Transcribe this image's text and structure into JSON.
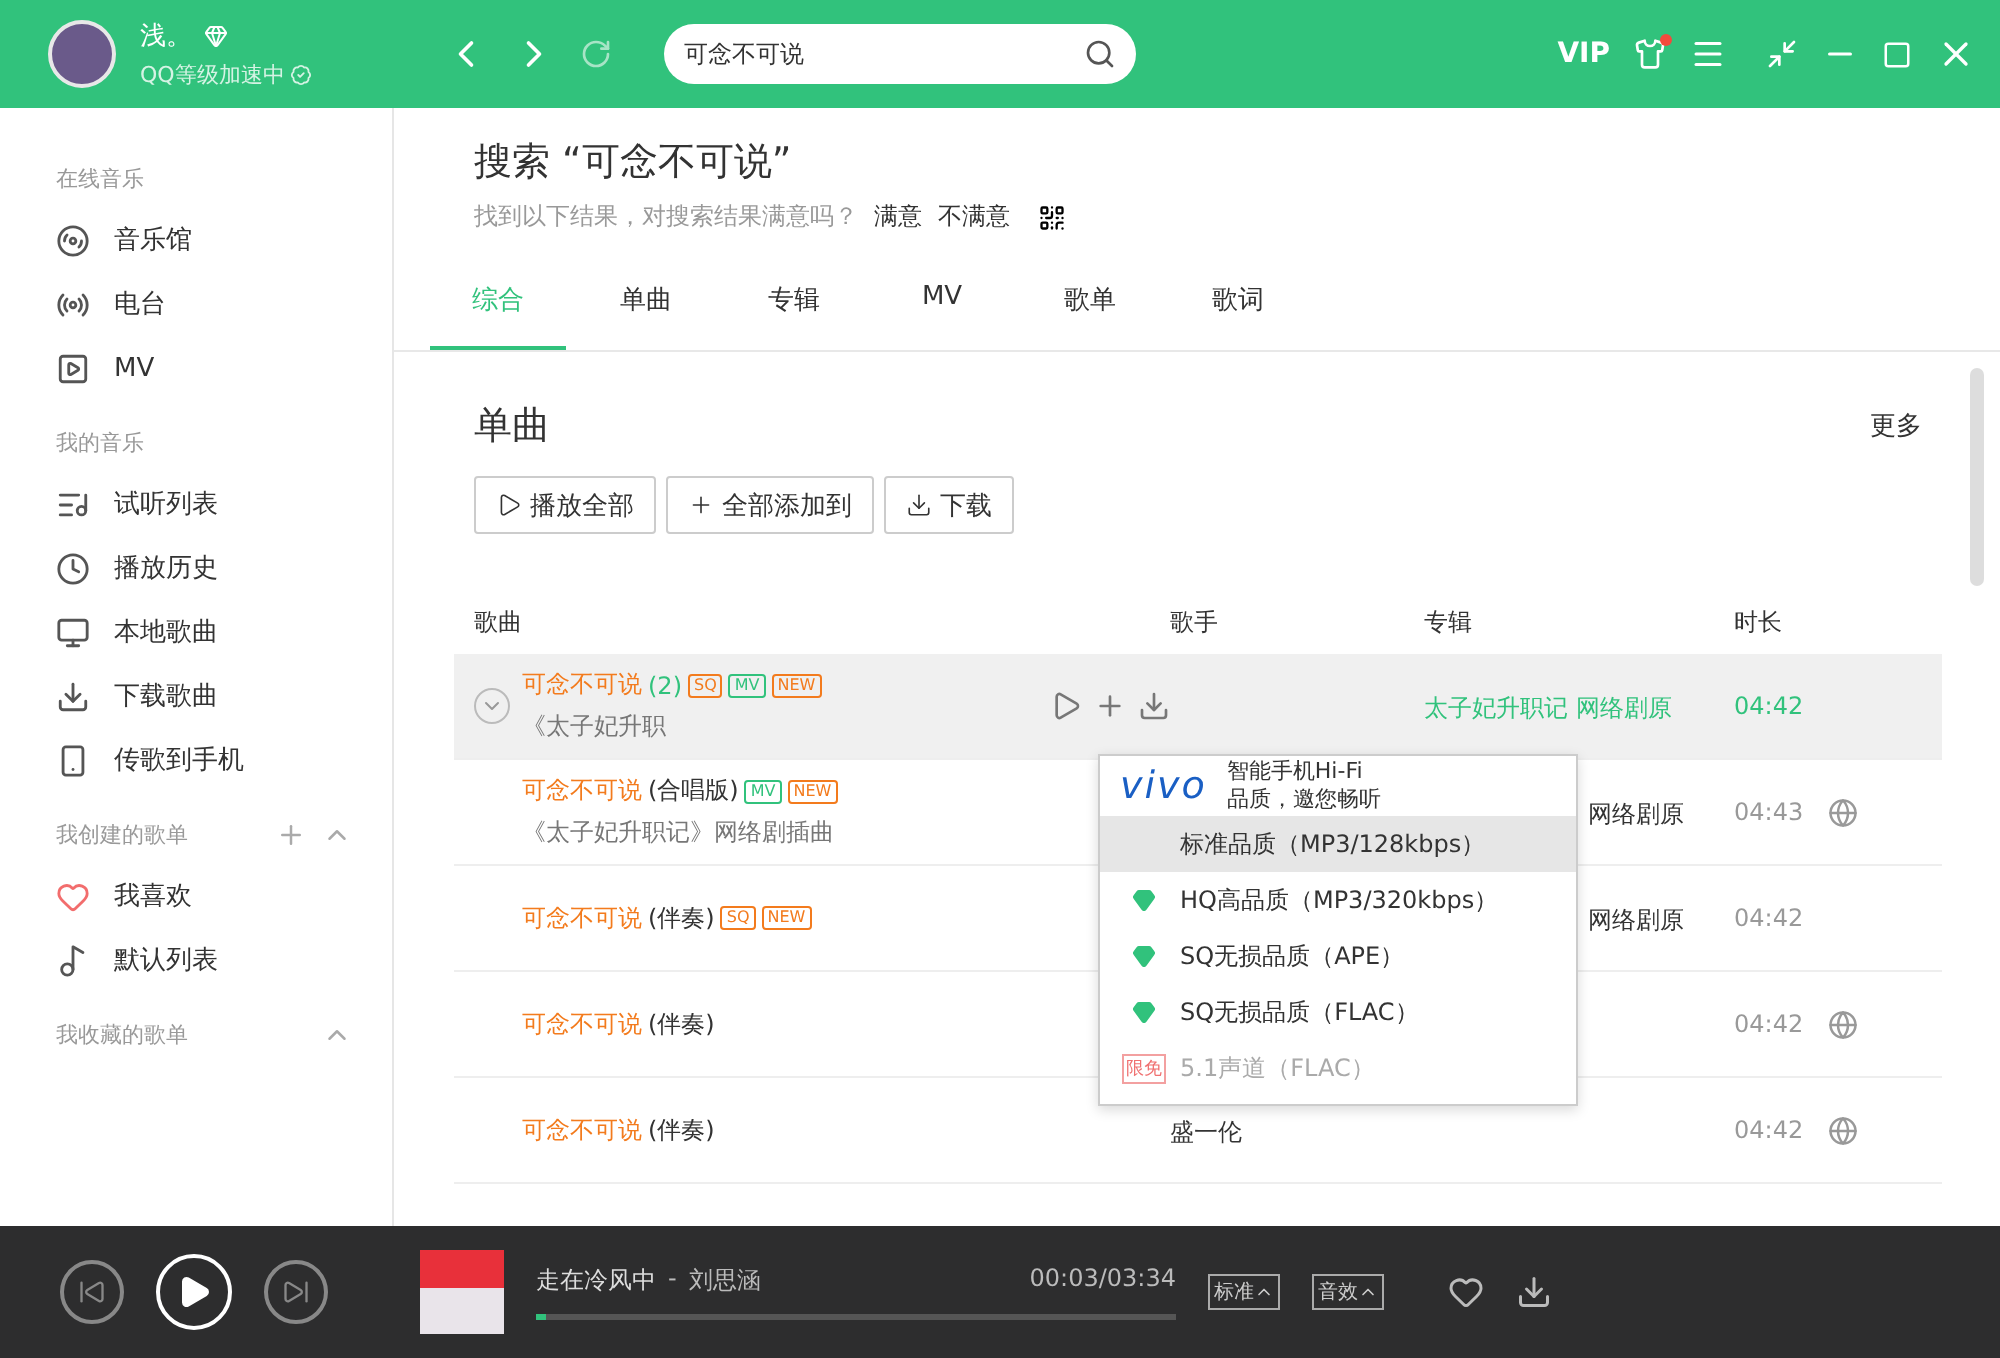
{
  "topbar": {
    "user_name": "浅。",
    "user_status": "QQ等级加速中",
    "search": {
      "value": "可念不可说"
    },
    "vip": "VIP"
  },
  "sidebar": {
    "sections": [
      {
        "title": "在线音乐",
        "items": [
          {
            "label": "音乐馆"
          },
          {
            "label": "电台"
          },
          {
            "label": "MV"
          }
        ]
      },
      {
        "title": "我的音乐",
        "items": [
          {
            "label": "试听列表"
          },
          {
            "label": "播放历史"
          },
          {
            "label": "本地歌曲"
          },
          {
            "label": "下载歌曲"
          },
          {
            "label": "传歌到手机"
          }
        ]
      },
      {
        "title": "我创建的歌单",
        "items": [
          {
            "label": "我喜欢"
          },
          {
            "label": "默认列表"
          }
        ]
      },
      {
        "title": "我收藏的歌单"
      }
    ]
  },
  "search_header": {
    "title": "搜索 “可念不可说”",
    "question": "找到以下结果，对搜索结果满意吗？",
    "options": [
      "满意",
      "不满意"
    ]
  },
  "tabs": [
    {
      "label": "综合",
      "selected": true
    },
    {
      "label": "单曲",
      "selected": false
    },
    {
      "label": "专辑",
      "selected": false
    },
    {
      "label": "MV",
      "selected": false
    },
    {
      "label": "歌单",
      "selected": false
    },
    {
      "label": "歌词",
      "selected": false
    }
  ],
  "section": {
    "title": "单曲",
    "more": "更多",
    "buttons": [
      "播放全部",
      "全部添加到",
      "下载"
    ]
  },
  "table": {
    "columns": [
      "歌曲",
      "歌手",
      "专辑",
      "时长"
    ],
    "rows": [
      {
        "selected": true,
        "title": "可念不可说",
        "suffix": "(2)",
        "tags": [
          "SQ",
          "MV",
          "NEW"
        ],
        "subtitle": "《太子妃升职",
        "album": "太子妃升职记 网络剧原",
        "duration": "04:42",
        "globe": false
      },
      {
        "selected": false,
        "title": "可念不可说",
        "suffix": "(合唱版)",
        "tags": [
          "MV",
          "NEW"
        ],
        "subtitle": "《太子妃升职记》网络剧插曲",
        "album": "网络剧原",
        "duration": "04:43",
        "globe": true
      },
      {
        "selected": false,
        "title": "可念不可说",
        "suffix": "(伴奏)",
        "tags": [
          "SQ",
          "NEW"
        ],
        "album": "网络剧原",
        "duration": "04:42",
        "globe": false
      },
      {
        "selected": false,
        "title": "可念不可说",
        "suffix": "(伴奏)",
        "duration": "04:42",
        "globe": true
      },
      {
        "selected": false,
        "title": "可念不可说",
        "suffix": "(伴奏)",
        "artist": "盛一伦",
        "duration": "04:42",
        "globe": true
      }
    ]
  },
  "quality_menu": {
    "ad": {
      "brand": "vivo",
      "line1": "智能手机Hi-Fi",
      "line2": "品质，邀您畅听"
    },
    "items": [
      {
        "label": "标准品质（MP3/128kbps）",
        "kind": "plain",
        "selected": true,
        "disabled": false
      },
      {
        "label": "HQ高品质（MP3/320kbps）",
        "kind": "diamond",
        "selected": false,
        "disabled": false
      },
      {
        "label": "SQ无损品质（APE）",
        "kind": "diamond",
        "selected": false,
        "disabled": false
      },
      {
        "label": "SQ无损品质（FLAC）",
        "kind": "diamond",
        "selected": false,
        "disabled": false
      },
      {
        "label": "5.1声道（FLAC）",
        "kind": "limited",
        "badge": "限免",
        "selected": false,
        "disabled": true
      }
    ]
  },
  "player": {
    "title": "走在冷风中",
    "separator": "-",
    "artist": "刘思涵",
    "time": "00:03/03:34",
    "level": 0.01,
    "quality": "标准",
    "effects": "音效"
  }
}
